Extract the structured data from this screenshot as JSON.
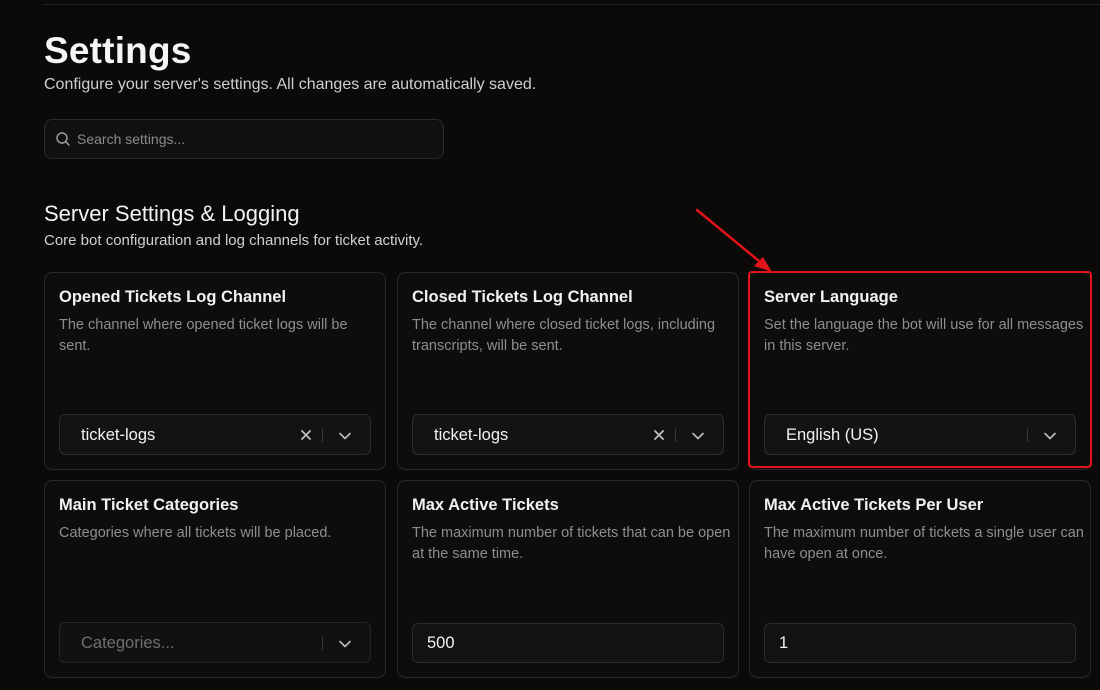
{
  "page": {
    "title": "Settings",
    "subtitle": "Configure your server's settings. All changes are automatically saved."
  },
  "search": {
    "placeholder": "Search settings...",
    "icon": "search-icon"
  },
  "section": {
    "title": "Server Settings & Logging",
    "description": "Core bot configuration and log channels for ticket activity."
  },
  "cards": [
    {
      "title": "Opened Tickets Log Channel",
      "description": "The channel where opened ticket logs will be sent.",
      "control": "select",
      "value": "ticket-logs"
    },
    {
      "title": "Closed Tickets Log Channel",
      "description": "The channel where closed ticket logs, including transcripts, will be sent.",
      "control": "select",
      "value": "ticket-logs"
    },
    {
      "title": "Server Language",
      "description": "Set the language the bot will use for all messages in this server.",
      "control": "select",
      "value": "English (US)"
    },
    {
      "title": "Main Ticket Categories",
      "description": "Categories where all tickets will be placed.",
      "control": "select",
      "placeholder": "Categories..."
    },
    {
      "title": "Max Active Tickets",
      "description": "The maximum number of tickets that can be open at the same time.",
      "control": "number",
      "value": "500"
    },
    {
      "title": "Max Active Tickets Per User",
      "description": "The maximum number of tickets a single user can have open at once.",
      "control": "number",
      "value": "1"
    }
  ],
  "colors": {
    "background": "#0b0a09",
    "card_border": "#2a2927",
    "annotation": "#e0141a"
  }
}
